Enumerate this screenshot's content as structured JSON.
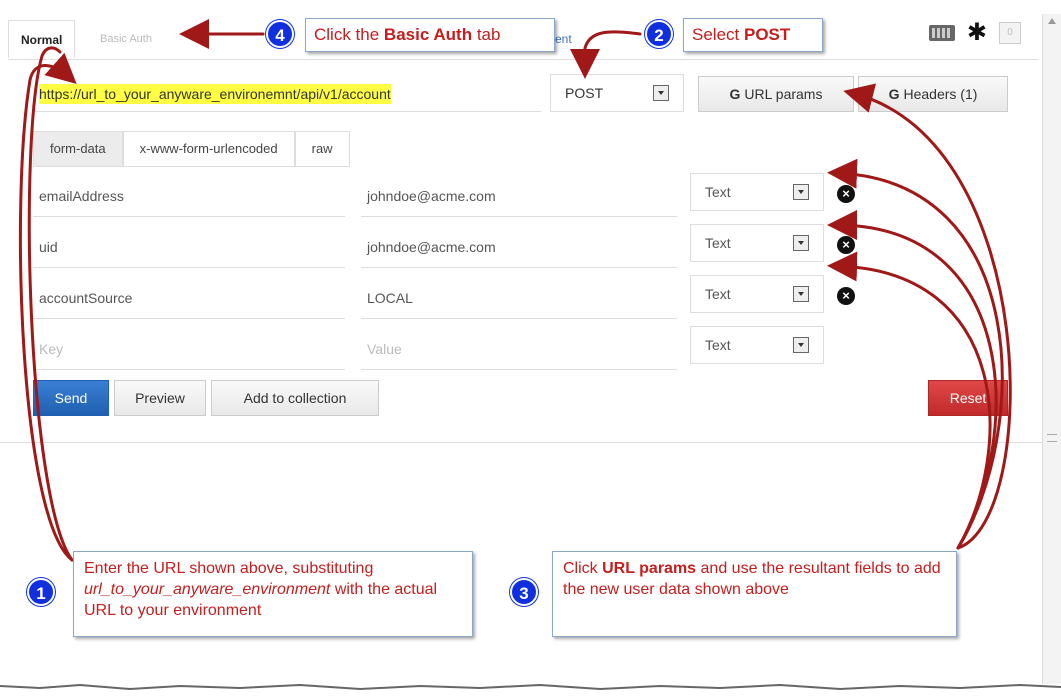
{
  "tabs": {
    "normal": "Normal",
    "basic_auth": "Basic Auth",
    "hidden_fragment": "ent"
  },
  "toolbar": {
    "counter": "0"
  },
  "request": {
    "url": "https://url_to_your_anyware_environemnt/api/v1/account",
    "method": "POST",
    "url_params_label": "URL params",
    "headers_label": "Headers (1)",
    "edit_glyph": "G"
  },
  "body_types": [
    "form-data",
    "x-www-form-urlencoded",
    "raw"
  ],
  "form_rows": [
    {
      "key": "emailAddress",
      "value": "johndoe@acme.com",
      "type": "Text"
    },
    {
      "key": "uid",
      "value": "johndoe@acme.com",
      "type": "Text"
    },
    {
      "key": "accountSource",
      "value": "LOCAL",
      "type": "Text"
    }
  ],
  "new_row": {
    "key_placeholder": "Key",
    "value_placeholder": "Value",
    "type": "Text"
  },
  "actions": {
    "send": "Send",
    "preview": "Preview",
    "add_to_collection": "Add to collection",
    "reset": "Reset"
  },
  "callouts": {
    "step1": {
      "number": "1",
      "text_before": "Enter the URL shown above, substituting ",
      "text_italic": "url_to_your_anyware_environment",
      "text_after": " with the actual URL to your environment"
    },
    "step2": {
      "number": "2",
      "text_before": "Select ",
      "text_bold": "POST"
    },
    "step3": {
      "number": "3",
      "text_before": "Click ",
      "text_bold": "URL params",
      "text_after": " and use the resultant fields to add the new user data shown above"
    },
    "step4": {
      "number": "4",
      "text_before": "Click the ",
      "text_bold": "Basic Auth",
      "text_after": " tab"
    }
  },
  "colors": {
    "callout_text": "#c41e1e",
    "arrow": "#a01818",
    "step_badge": "#1030e0",
    "send_button": "#2a6cc4",
    "reset_button": "#d03838",
    "url_highlight": "#ffff44"
  }
}
